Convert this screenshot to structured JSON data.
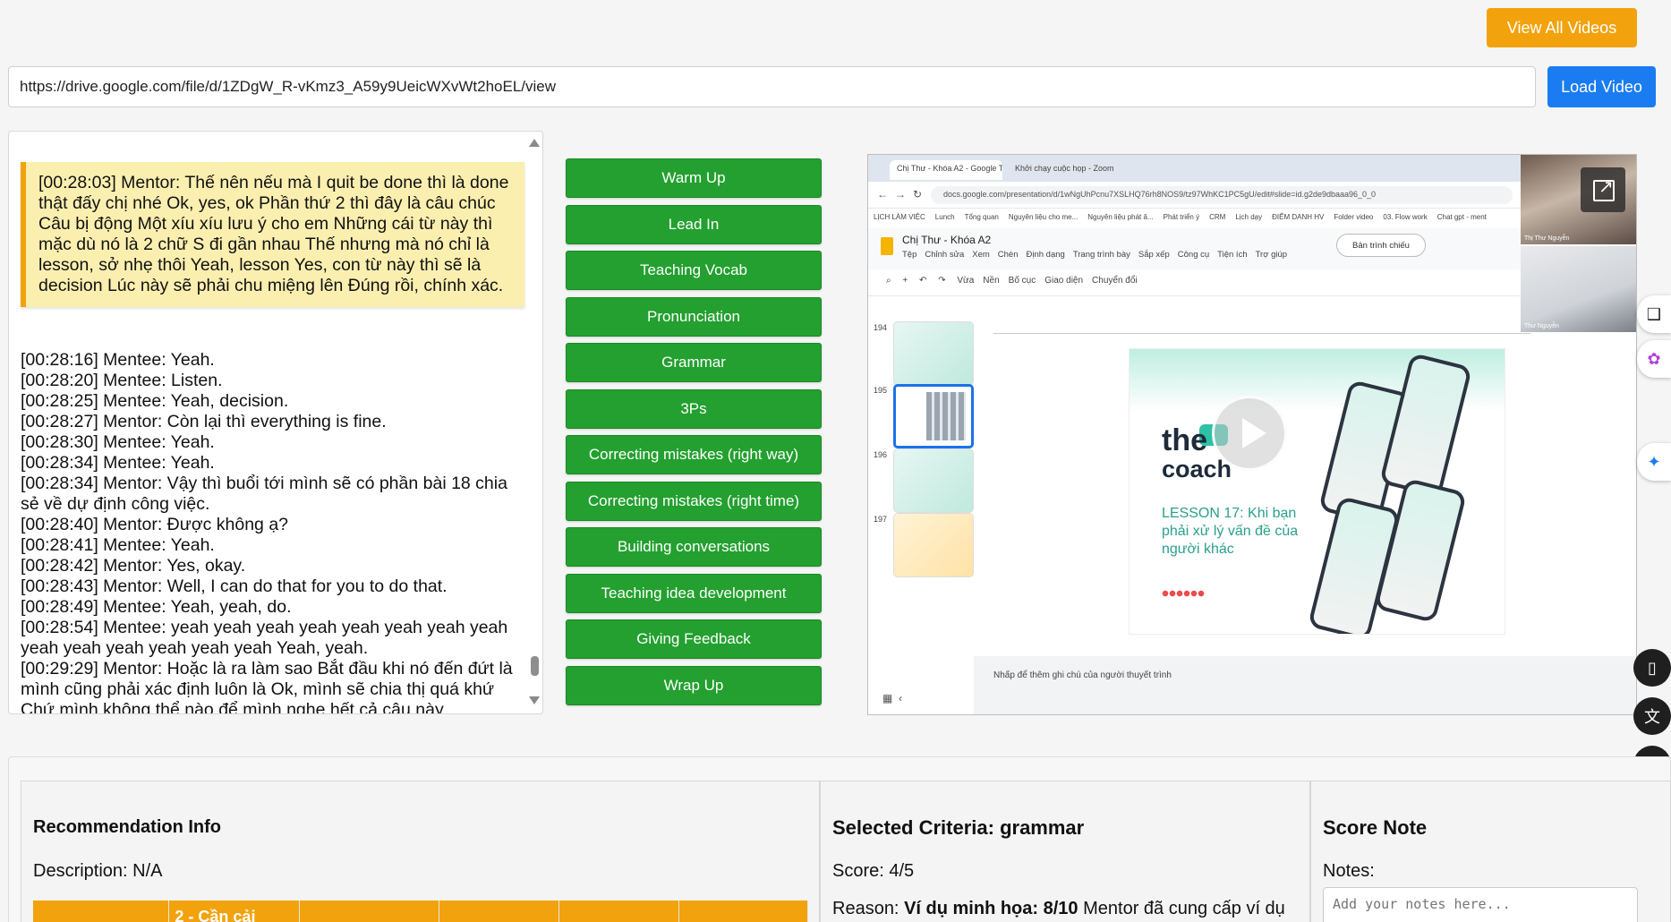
{
  "top": {
    "view_all_label": "View All Videos",
    "url_value": "https://drive.google.com/file/d/1ZDgW_R-vKmz3_A59y9UeicWXvWt2hoEL/view",
    "load_label": "Load Video"
  },
  "transcript": {
    "highlight": "[00:28:03] Mentor: Thế nên nếu mà I quit be done thì là done thật đấy chị nhé Ok, yes, ok Phần thứ 2 thì đây là câu chúc Câu bị động Một xíu xíu lưu ý cho em Những cái từ này thì mặc dù nó là 2 chữ S đi gần nhau Thế nhưng mà nó chỉ là lesson, sở nhẹ thôi Yeah, lesson Yes, con từ này thì sẽ là decision Lúc này sẽ phải chu miệng lên Đúng rồi, chính xác.",
    "lines": [
      "[00:28:16] Mentee: Yeah.",
      "[00:28:20] Mentee: Listen.",
      "[00:28:25] Mentee: Yeah, decision.",
      "[00:28:27] Mentor: Còn lại thì everything is fine.",
      "[00:28:30] Mentee: Yeah.",
      "[00:28:34] Mentee: Yeah.",
      "[00:28:34] Mentor: Vậy thì buổi tới mình sẽ có phần bài 18 chia sẻ về dự định công việc.",
      "[00:28:40] Mentor: Được không ạ?",
      "[00:28:41] Mentee: Yeah.",
      "[00:28:42] Mentor: Yes, okay.",
      "[00:28:43] Mentor: Well, I can do that for you to do that.",
      "[00:28:49] Mentee: Yeah, yeah, do.",
      "[00:28:54] Mentee: yeah yeah yeah yeah yeah yeah yeah yeah yeah yeah yeah yeah yeah yeah Yeah, yeah.",
      "[00:29:29] Mentor: Hoặc là ra làm sao Bắt đầu khi nó đến đứt là mình cũng phải xác định luôn là Ok, mình sẽ chia thị quá khứ Chứ mình không thể nào để mình nghe hết cả câu này"
    ]
  },
  "criteria": [
    "Warm Up",
    "Lead In",
    "Teaching Vocab",
    "Pronunciation",
    "Grammar",
    "3Ps",
    "Correcting mistakes (right way)",
    "Correcting mistakes (right time)",
    "Building conversations",
    "Teaching idea development",
    "Giving Feedback",
    "Wrap Up"
  ],
  "video": {
    "tab1": "Chị Thư - Khóa A2 - Google Tr",
    "tab2": "Khởi chạy cuộc họp - Zoom",
    "address": "docs.google.com/presentation/d/1wNgUhPcnu7XSLHQ76rh8NOS9/tz97WhKC1PC5gU/edit#slide=id.g2de9dbaaa96_0_0",
    "bookmarks": [
      "LỊCH LÀM VIỆC",
      "Lunch",
      "Tổng quan",
      "Nguyên liệu cho me...",
      "Nguyên liệu phát â...",
      "Phát triển ý",
      "CRM",
      "Lịch dạy",
      "ĐIỂM DANH HV",
      "Folder video",
      "03. Flow work",
      "Chat gpt - ment"
    ],
    "doc_title": "Chị Thư - Khóa A2",
    "doc_menu": [
      "Tệp",
      "Chỉnh sửa",
      "Xem",
      "Chèn",
      "Định dạng",
      "Trang trình bày",
      "Sắp xếp",
      "Công cụ",
      "Tiện ích",
      "Trợ giúp"
    ],
    "slideshow_label": "Bản trình chiếu",
    "toolbar": [
      "Vừa",
      "Nền",
      "Bố cục",
      "Giao diện",
      "Chuyển đổi"
    ],
    "slide_numbers": [
      "194",
      "195",
      "196",
      "197"
    ],
    "logo_top": "the",
    "logo_bottom": "coach",
    "lesson_text": "LESSON 17: Khi bạn phải xử lý vấn đề của người khác",
    "notes_placeholder": "Nhấp để thêm ghi chú của người thuyết trình",
    "cam1_name": "Thị Thư Nguyễn",
    "cam2_name": "Thư Nguyễn"
  },
  "recommendation": {
    "title": "Recommendation Info",
    "description": "Description: N/A",
    "table_headers": [
      "",
      "2 - Cần cải",
      "",
      "",
      "",
      ""
    ]
  },
  "selected": {
    "title": "Selected Criteria: grammar",
    "score": "Score: 4/5",
    "reason_prefix": "Reason: ",
    "reason_bold": "Ví dụ minh họa: 8/10",
    "reason_rest": " Mentor đã cung cấp ví dụ"
  },
  "score_note": {
    "title": "Score Note",
    "notes_label": "Notes:",
    "placeholder": "Add your notes here..."
  }
}
